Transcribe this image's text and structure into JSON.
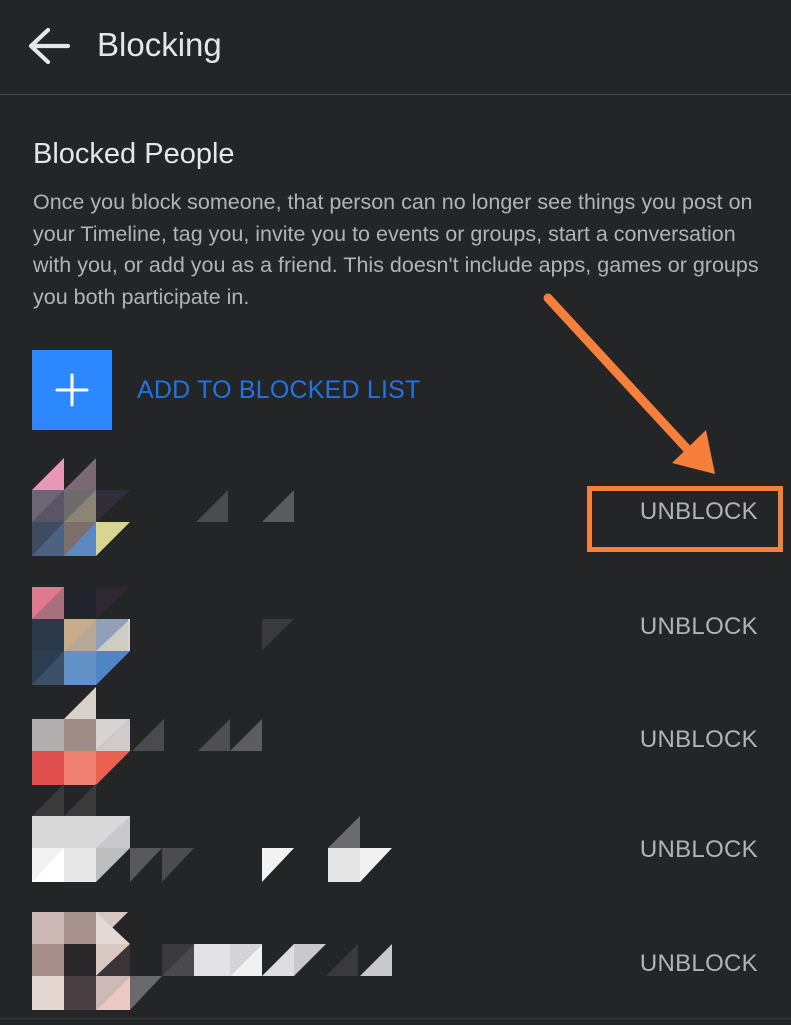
{
  "header": {
    "title": "Blocking",
    "back_icon": "arrow-left-icon"
  },
  "section": {
    "title": "Blocked People",
    "description": "Once you block someone, that person can no longer see things you post on your Timeline, tag you, invite you to events or groups, start a conversation with you, or add you as a friend. This doesn't include apps, games or groups you both participate in."
  },
  "add_button": {
    "label": "ADD TO BLOCKED LIST",
    "icon": "plus-icon"
  },
  "blocked_list": [
    {
      "unblock_label": "UNBLOCK"
    },
    {
      "unblock_label": "UNBLOCK"
    },
    {
      "unblock_label": "UNBLOCK"
    },
    {
      "unblock_label": "UNBLOCK"
    },
    {
      "unblock_label": "UNBLOCK"
    }
  ],
  "colors": {
    "background": "#242526",
    "primary_text": "#e4e6eb",
    "secondary_text": "#b0b3b8",
    "accent_blue": "#2d88ff",
    "link_blue": "#2374e1",
    "annotation_orange": "#f57f3b"
  }
}
